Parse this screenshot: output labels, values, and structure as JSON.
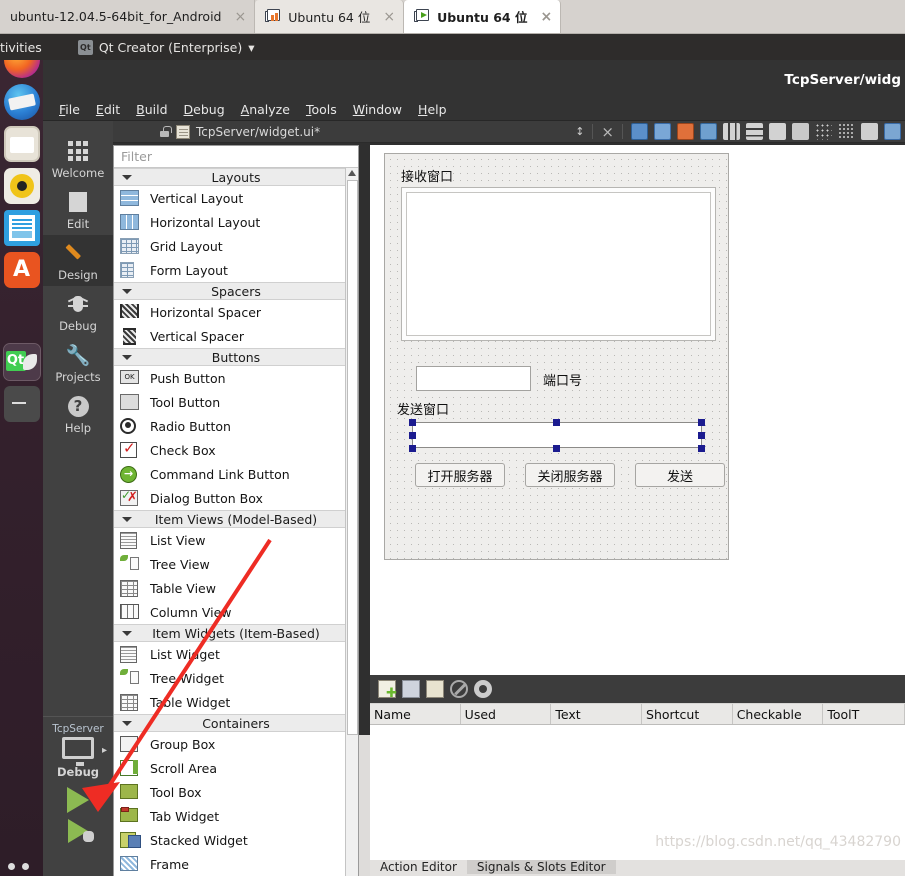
{
  "vmware_tabs": [
    {
      "label": "ubuntu-12.04.5-64bit_for_Android",
      "icon": "none",
      "state": "inactive",
      "close": "×"
    },
    {
      "label": "Ubuntu 64 位",
      "icon": "vm-suspended-icon",
      "state": "inactive",
      "close": "×"
    },
    {
      "label": "Ubuntu 64 位",
      "icon": "vm-running-icon",
      "state": "active",
      "close": "×"
    }
  ],
  "unity": {
    "activities_label": "tivities",
    "app_menu": {
      "label": "Qt Creator (Enterprise)",
      "caret": "▾",
      "icon": "qt-logo-icon"
    },
    "launcher_items": [
      {
        "name": "firefox-icon"
      },
      {
        "name": "thunderbird-icon"
      },
      {
        "name": "files-icon"
      },
      {
        "name": "rhythmbox-icon"
      },
      {
        "name": "libreoffice-icon"
      },
      {
        "name": "ubuntu-software-icon"
      },
      {
        "name": "qt-creator-icon"
      },
      {
        "name": "terminal-icon"
      }
    ]
  },
  "qtcreator": {
    "window_title": "TcpServer/widg",
    "menu": [
      "File",
      "Edit",
      "Build",
      "Debug",
      "Analyze",
      "Tools",
      "Window",
      "Help"
    ],
    "modes": [
      {
        "label": "Welcome",
        "icon": "grid-icon",
        "active": false
      },
      {
        "label": "Edit",
        "icon": "document-icon",
        "active": false
      },
      {
        "label": "Design",
        "icon": "pencil-icon",
        "active": true
      },
      {
        "label": "Debug",
        "icon": "bug-icon",
        "active": false
      },
      {
        "label": "Projects",
        "icon": "wrench-icon",
        "active": false
      },
      {
        "label": "Help",
        "icon": "question-icon",
        "active": false
      }
    ],
    "run_panel": {
      "project": "TcpServer",
      "kit_icon": "desktop-monitor-icon",
      "kit_label": "Debug",
      "run_icon": "run-triangle-icon",
      "debug_icon": "debug-triangle-icon",
      "expand_arrow": "▸"
    },
    "editor_bar": {
      "lock_icon": "unlocked-icon",
      "file_icon": "ui-file-icon",
      "filename": "TcpServer/widget.ui*",
      "updown_icon": "updown-arrows-icon",
      "close_icon": "×",
      "tools": [
        "edit-widgets-icon",
        "edit-signals-slots-icon",
        "edit-buddies-icon",
        "edit-tab-order-icon",
        "layout-horizontally-icon",
        "layout-vertically-icon",
        "layout-splitter-h-icon",
        "layout-splitter-v-icon",
        "layout-form-icon",
        "layout-grid-icon",
        "break-layout-icon",
        "adjust-size-icon"
      ]
    }
  },
  "widget_box": {
    "filter_placeholder": "Filter",
    "scroll_up_arrow": "▲",
    "sections": [
      {
        "title": "Layouts",
        "items": [
          {
            "label": "Vertical Layout",
            "icon": "vertical-layout-icon"
          },
          {
            "label": "Horizontal Layout",
            "icon": "horizontal-layout-icon"
          },
          {
            "label": "Grid Layout",
            "icon": "grid-layout-icon"
          },
          {
            "label": "Form Layout",
            "icon": "form-layout-icon"
          }
        ]
      },
      {
        "title": "Spacers",
        "items": [
          {
            "label": "Horizontal Spacer",
            "icon": "horizontal-spacer-icon"
          },
          {
            "label": "Vertical Spacer",
            "icon": "vertical-spacer-icon"
          }
        ]
      },
      {
        "title": "Buttons",
        "items": [
          {
            "label": "Push Button",
            "icon": "push-button-icon"
          },
          {
            "label": "Tool Button",
            "icon": "tool-button-icon"
          },
          {
            "label": "Radio Button",
            "icon": "radio-button-icon"
          },
          {
            "label": "Check Box",
            "icon": "check-box-icon"
          },
          {
            "label": "Command Link Button",
            "icon": "command-link-button-icon"
          },
          {
            "label": "Dialog Button Box",
            "icon": "dialog-button-box-icon"
          }
        ]
      },
      {
        "title": "Item Views (Model-Based)",
        "items": [
          {
            "label": "List View",
            "icon": "list-view-icon"
          },
          {
            "label": "Tree View",
            "icon": "tree-view-icon"
          },
          {
            "label": "Table View",
            "icon": "table-view-icon"
          },
          {
            "label": "Column View",
            "icon": "column-view-icon"
          }
        ]
      },
      {
        "title": "Item Widgets (Item-Based)",
        "items": [
          {
            "label": "List Widget",
            "icon": "list-widget-icon"
          },
          {
            "label": "Tree Widget",
            "icon": "tree-widget-icon"
          },
          {
            "label": "Table Widget",
            "icon": "table-widget-icon"
          }
        ]
      },
      {
        "title": "Containers",
        "items": [
          {
            "label": "Group Box",
            "icon": "group-box-icon"
          },
          {
            "label": "Scroll Area",
            "icon": "scroll-area-icon"
          },
          {
            "label": "Tool Box",
            "icon": "tool-box-icon"
          },
          {
            "label": "Tab Widget",
            "icon": "tab-widget-icon"
          },
          {
            "label": "Stacked Widget",
            "icon": "stacked-widget-icon"
          },
          {
            "label": "Frame",
            "icon": "frame-icon"
          }
        ]
      }
    ]
  },
  "form": {
    "receive_label": "接收窗口",
    "port_input_value": "",
    "port_label": "端口号",
    "send_label": "发送窗口",
    "send_input_value": "",
    "buttons": [
      {
        "label": "打开服务器"
      },
      {
        "label": "关闭服务器"
      },
      {
        "label": "发送"
      }
    ],
    "selection_handle_color": "#1b1b8f"
  },
  "action_editor": {
    "toolbar_icons": [
      "new-action-icon",
      "copy-icon",
      "paste-icon",
      "delete-icon",
      "edit-settings-icon"
    ],
    "columns": [
      "Name",
      "Used",
      "Text",
      "Shortcut",
      "Checkable",
      "ToolT"
    ],
    "rows": [],
    "tabs": [
      {
        "label": "Action Editor",
        "active": false
      },
      {
        "label": "Signals & Slots Editor",
        "active": true
      }
    ]
  },
  "watermark": "https://blog.csdn.net/qq_43482790",
  "colors": {
    "qt_dark": "#333333",
    "mode_bar": "#414141",
    "form_bg": "#efeeec",
    "accent_orange": "#e08a1e",
    "run_green": "#8cba52",
    "arrow_red": "#ee2c24"
  }
}
